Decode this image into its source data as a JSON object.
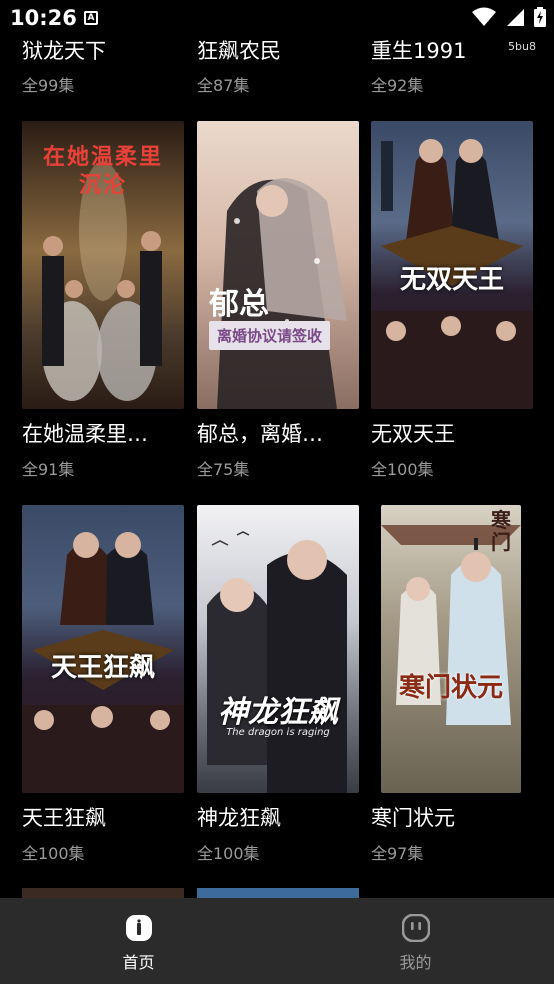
{
  "status": {
    "time": "10:26",
    "code": "5bu8"
  },
  "top_row": [
    {
      "title": "狱龙天下",
      "episodes": "全99集"
    },
    {
      "title": "狂飙农民",
      "episodes": "全87集"
    },
    {
      "title": "重生1991",
      "episodes": "全92集"
    }
  ],
  "row1": [
    {
      "title": "在她温柔里…",
      "episodes": "全91集",
      "poster_text": "在她温柔里沉沦",
      "poster_colors": [
        "#3a2a1e",
        "#8a6a40",
        "#2a1c14"
      ]
    },
    {
      "title": "郁总，离婚…",
      "episodes": "全75集",
      "poster_text": "郁总",
      "poster_sub": "离婚协议请签收",
      "poster_colors": [
        "#e8d6c8",
        "#c9a99a",
        "#7a5f55"
      ]
    },
    {
      "title": "无双天王",
      "episodes": "全100集",
      "poster_text": "无双天王",
      "poster_colors": [
        "#2e3a52",
        "#5a6b88",
        "#3a1e1e"
      ]
    }
  ],
  "row2": [
    {
      "title": "天王狂飙",
      "episodes": "全100集",
      "poster_text": "天王狂飙",
      "poster_colors": [
        "#2e3a52",
        "#4d5e7c",
        "#3a1e1e"
      ]
    },
    {
      "title": "神龙狂飙",
      "episodes": "全100集",
      "poster_text": "神龙狂飙",
      "poster_sub": "The dragon is raging",
      "poster_colors": [
        "#e6e6ea",
        "#8a8c96",
        "#2a2c34"
      ]
    },
    {
      "title": "寒门状元",
      "episodes": "全97集",
      "poster_text": "寒门状元",
      "poster_colors": [
        "#c9c3b4",
        "#8f8572",
        "#5e5848"
      ]
    }
  ],
  "nav": [
    {
      "label": "首页",
      "icon": "home-icon",
      "color": "#ffffff"
    },
    {
      "label": "我的",
      "icon": "profile-icon",
      "color": "#9a9a9a"
    }
  ]
}
